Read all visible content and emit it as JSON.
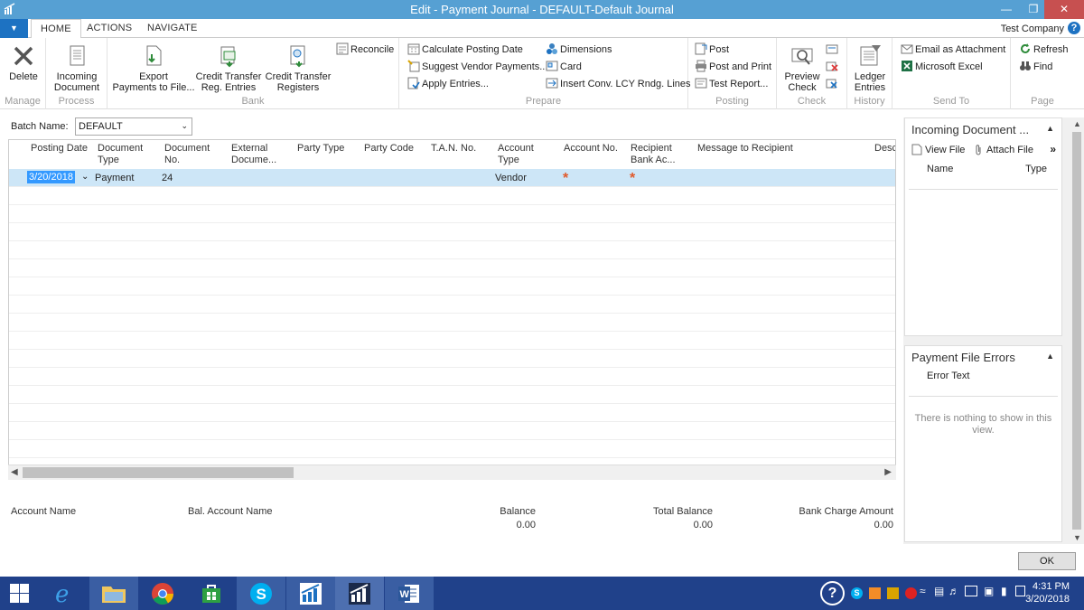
{
  "window": {
    "title": "Edit - Payment Journal - DEFAULT-Default Journal",
    "company": "Test Company"
  },
  "tabs": [
    "HOME",
    "ACTIONS",
    "NAVIGATE"
  ],
  "ribbon": {
    "manage": {
      "group": "Manage",
      "delete": "Delete"
    },
    "process": {
      "group": "Process",
      "incoming_document_l1": "Incoming",
      "incoming_document_l2": "Document"
    },
    "bank": {
      "group": "Bank",
      "export_l1": "Export",
      "export_l2": "Payments to File...",
      "ct_reg_l1": "Credit Transfer",
      "ct_reg_l2": "Reg. Entries",
      "ct_regs_l1": "Credit Transfer",
      "ct_regs_l2": "Registers",
      "reconcile": "Reconcile"
    },
    "prepare": {
      "group": "Prepare",
      "calc_posting_date": "Calculate Posting Date",
      "suggest_vendor_payments": "Suggest Vendor Payments...",
      "apply_entries": "Apply Entries...",
      "dimensions": "Dimensions",
      "card": "Card",
      "insert_conv": "Insert Conv. LCY Rndg. Lines"
    },
    "posting": {
      "group": "Posting",
      "post": "Post",
      "post_and_print": "Post and Print",
      "test_report": "Test Report..."
    },
    "check": {
      "group": "Check",
      "preview_l1": "Preview",
      "preview_l2": "Check"
    },
    "history": {
      "group": "History",
      "ledger_l1": "Ledger",
      "ledger_l2": "Entries"
    },
    "sendto": {
      "group": "Send To",
      "email_attachment": "Email as Attachment",
      "excel": "Microsoft Excel"
    },
    "page": {
      "group": "Page",
      "refresh": "Refresh",
      "find": "Find"
    }
  },
  "batch": {
    "label": "Batch Name:",
    "value": "DEFAULT"
  },
  "grid": {
    "columns": [
      {
        "l1": "Posting Date",
        "l2": ""
      },
      {
        "l1": "Document",
        "l2": "Type"
      },
      {
        "l1": "Document",
        "l2": "No."
      },
      {
        "l1": "External",
        "l2": "Docume..."
      },
      {
        "l1": "Party Type",
        "l2": ""
      },
      {
        "l1": "Party Code",
        "l2": ""
      },
      {
        "l1": "T.A.N. No.",
        "l2": ""
      },
      {
        "l1": "Account",
        "l2": "Type"
      },
      {
        "l1": "Account No.",
        "l2": ""
      },
      {
        "l1": "Recipient",
        "l2": "Bank Ac..."
      },
      {
        "l1": "Message to Recipient",
        "l2": ""
      },
      {
        "l1": "Desc",
        "l2": ""
      }
    ],
    "row": {
      "posting_date": "3/20/2018",
      "document_type": "Payment",
      "document_no": "24",
      "account_type": "Vendor",
      "required_marker": "*"
    }
  },
  "footer": {
    "account_name": "Account Name",
    "bal_account_name": "Bal. Account Name",
    "balance_label": "Balance",
    "balance_value": "0.00",
    "total_balance_label": "Total Balance",
    "total_balance_value": "0.00",
    "bank_charge_label": "Bank Charge Amount",
    "bank_charge_value": "0.00"
  },
  "factbox_incoming": {
    "title": "Incoming Document ...",
    "view_file": "View File",
    "attach_file": "Attach File",
    "col_name": "Name",
    "col_type": "Type"
  },
  "factbox_errors": {
    "title": "Payment File Errors",
    "col_error": "Error Text",
    "empty": "There is nothing to show in this view."
  },
  "ok": "OK",
  "taskbar": {
    "time": "4:31 PM",
    "date": "3/20/2018"
  },
  "colors": {
    "titlebar": "#56a0d3",
    "accent": "#1d72c2",
    "selection": "#cde6f7",
    "taskbar": "#20418a",
    "required": "#e05a2b"
  }
}
